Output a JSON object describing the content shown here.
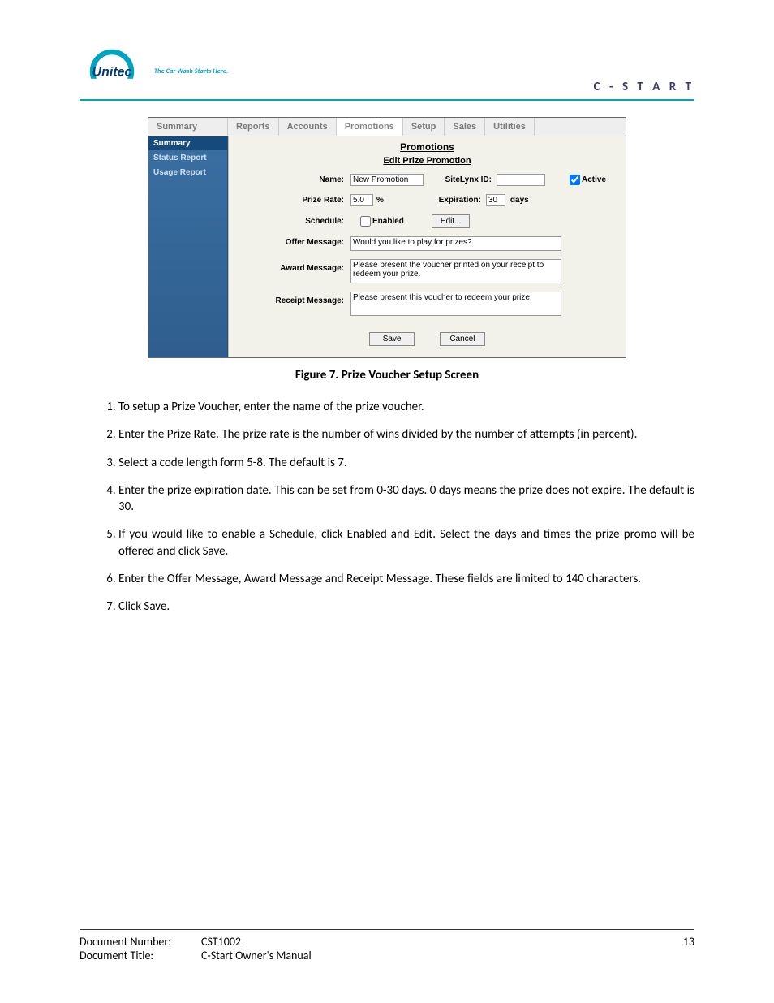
{
  "header": {
    "tagline": "The Car Wash Starts Here.",
    "section": "C - S T A R T"
  },
  "screenshot": {
    "tabs": [
      "Summary",
      "Reports",
      "Accounts",
      "Promotions",
      "Setup",
      "Sales",
      "Utilities"
    ],
    "sidebar": [
      "Summary",
      "Status Report",
      "Usage Report"
    ],
    "panel_title": "Promotions",
    "panel_subtitle": "Edit Prize Promotion",
    "labels": {
      "name": "Name:",
      "sitelynx": "SiteLynx ID:",
      "active": "Active",
      "prize_rate": "Prize Rate:",
      "percent": "%",
      "expiration": "Expiration:",
      "days": "days",
      "schedule": "Schedule:",
      "enabled": "Enabled",
      "edit": "Edit...",
      "offer": "Offer Message:",
      "award": "Award Message:",
      "receipt": "Receipt Message:",
      "save": "Save",
      "cancel": "Cancel"
    },
    "values": {
      "name": "New Promotion",
      "sitelynx": "",
      "active_checked": true,
      "prize_rate": "5.0",
      "expiration": "30",
      "enabled_checked": false,
      "offer": "Would you like to play for prizes?",
      "award": "Please present the voucher printed on your receipt to redeem your prize.",
      "receipt": "Please present this voucher to redeem your prize."
    }
  },
  "caption": "Figure 7. Prize Voucher Setup Screen",
  "steps": [
    "To setup a Prize Voucher, enter the name of the prize voucher.",
    "Enter the Prize Rate. The prize rate is the number of wins divided by the number of attempts (in percent).",
    "Select a code length form 5-8. The default is 7.",
    "Enter the prize expiration date. This can be set from 0-30 days. 0 days means the prize does not expire. The default is 30.",
    "If you would like to enable a Schedule, click Enabled and Edit. Select the days and times the prize promo will be offered and click Save.",
    "Enter the Offer Message, Award Message and Receipt Message. These fields are limited to 140 characters.",
    "Click Save."
  ],
  "footer": {
    "docnum_label": "Document Number:",
    "docnum": "CST1002",
    "title_label": "Document Title:",
    "title": "C-Start Owner's Manual",
    "page": "13"
  }
}
